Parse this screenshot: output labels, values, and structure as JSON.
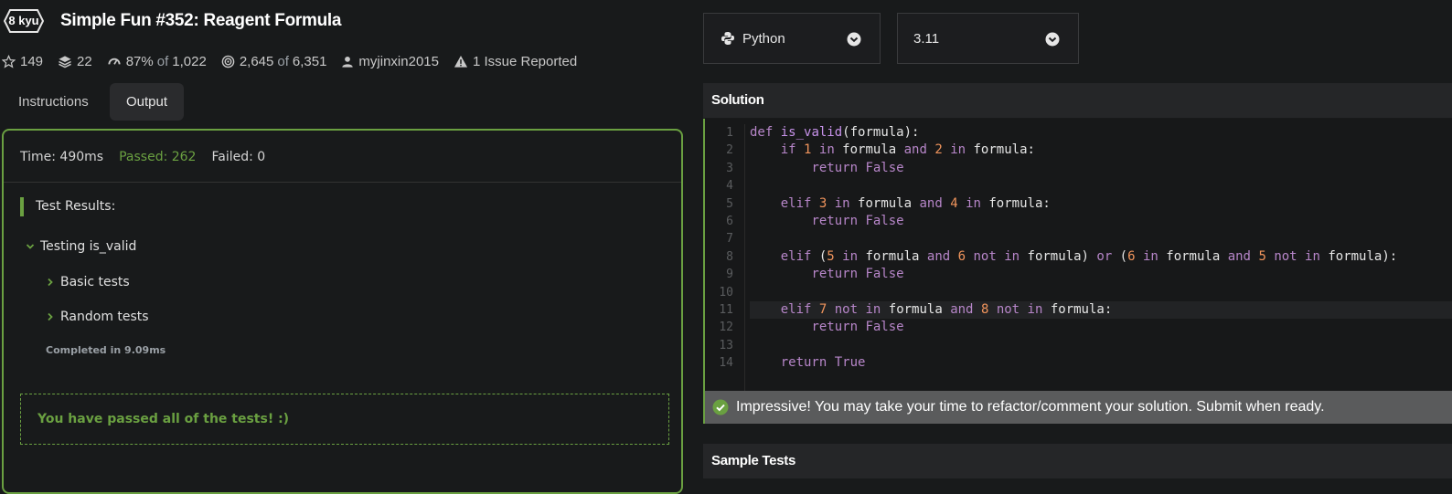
{
  "kata": {
    "rank": "8 kyu",
    "title": "Simple Fun #352: Reagent Formula",
    "stats": {
      "stars": "149",
      "collections": "22",
      "satisfaction_pct": "87%",
      "satisfaction_of": "of",
      "satisfaction_votes": "1,022",
      "completed": "2,645",
      "completed_of": "of",
      "attempted": "6,351",
      "author": "myjinxin2015",
      "issues": "1 Issue Reported"
    }
  },
  "tabs": [
    {
      "label": "Instructions",
      "active": false
    },
    {
      "label": "Output",
      "active": true
    }
  ],
  "output": {
    "time": "Time: 490ms",
    "passed": "Passed: 262",
    "failed": "Failed: 0",
    "results_label": "Test Results:",
    "group": "Testing is_valid",
    "tests": [
      "Basic tests",
      "Random tests"
    ],
    "completed": "Completed in 9.09ms",
    "pass_message": "You have passed all of the tests! :)"
  },
  "language": {
    "selected": "Python"
  },
  "version": {
    "selected": "3.11"
  },
  "solution": {
    "header": "Solution",
    "line_numbers": [
      "1",
      "2",
      "3",
      "4",
      "5",
      "6",
      "7",
      "8",
      "9",
      "10",
      "11",
      "12",
      "13",
      "14"
    ],
    "status": "Impressive! You may take your time to refactor/comment your solution. Submit when ready."
  },
  "sample_tests": {
    "header": "Sample Tests"
  },
  "colors": {
    "accent_green": "#6aa041",
    "keyword": "#b786c9",
    "number": "#f0945c",
    "background": "#181a1b"
  }
}
